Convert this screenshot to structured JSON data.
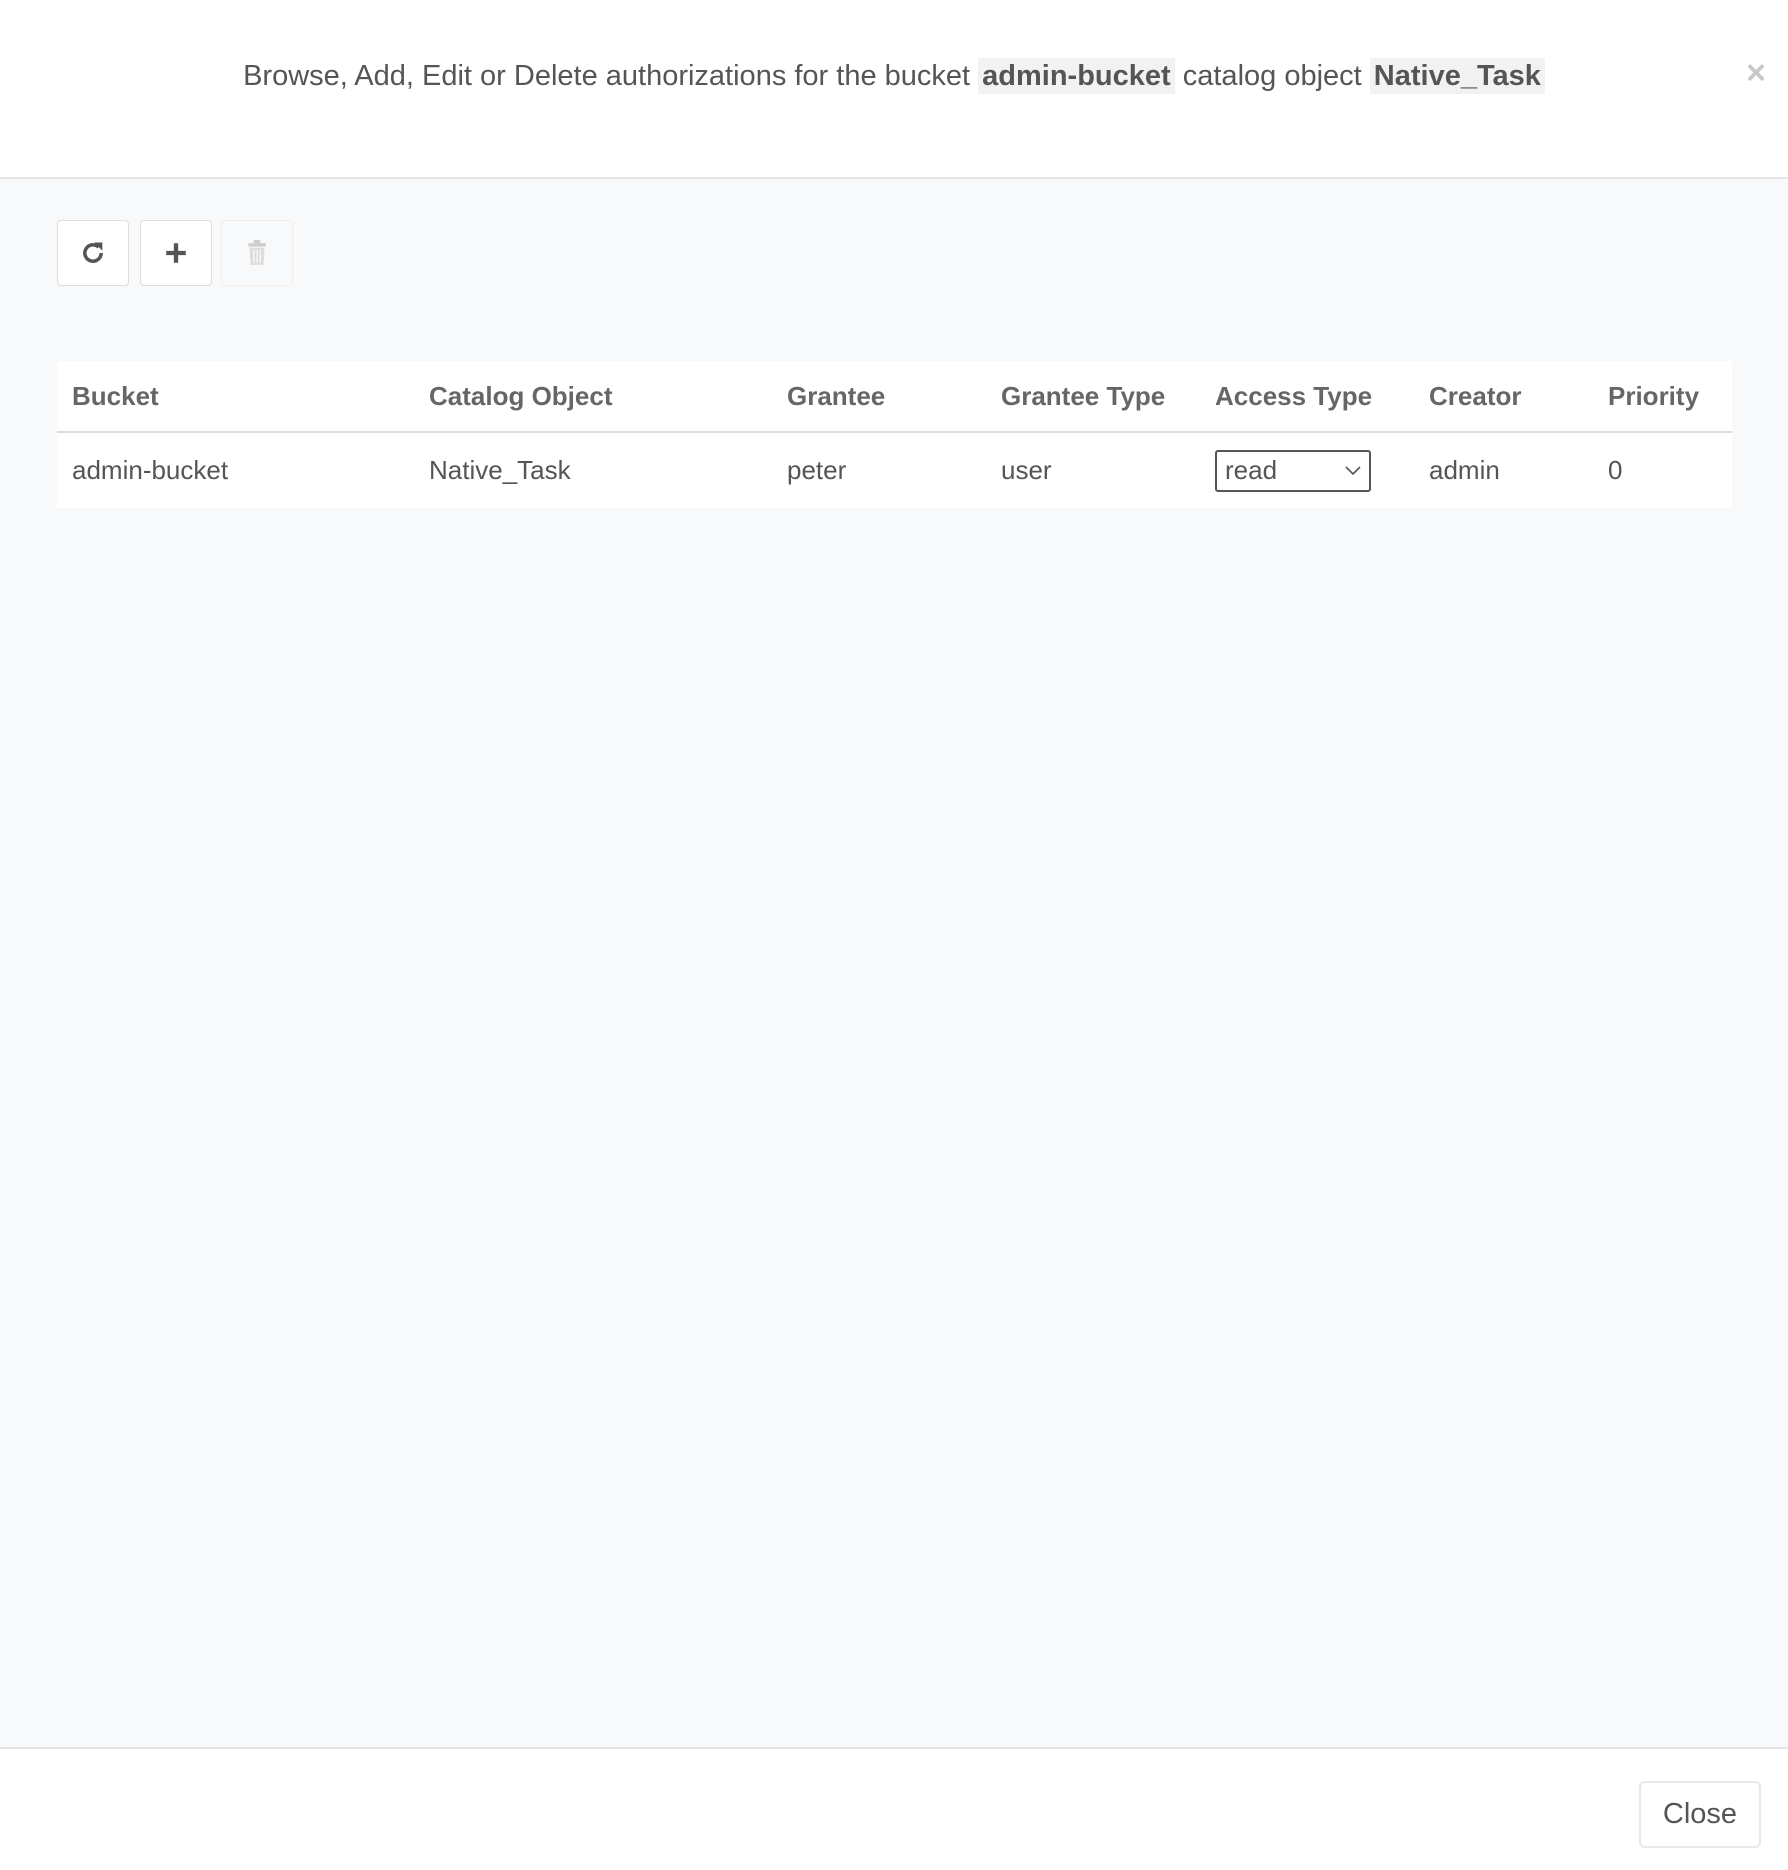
{
  "header": {
    "title_prefix": "Browse, Add, Edit or Delete authorizations for the bucket",
    "bucket": "admin-bucket",
    "title_middle": "catalog object",
    "object": "Native_Task",
    "close_icon": "×"
  },
  "toolbar": {
    "refresh_icon": "refresh-icon",
    "add_icon": "plus-icon",
    "delete_icon": "trash-icon",
    "delete_disabled": true
  },
  "table": {
    "columns": [
      "Bucket",
      "Catalog Object",
      "Grantee",
      "Grantee Type",
      "Access Type",
      "Creator",
      "Priority"
    ],
    "rows": [
      {
        "bucket": "admin-bucket",
        "catalog_object": "Native_Task",
        "grantee": "peter",
        "grantee_type": "user",
        "access_type": "read",
        "creator": "admin",
        "priority": "0"
      }
    ]
  },
  "footer": {
    "close_label": "Close"
  }
}
